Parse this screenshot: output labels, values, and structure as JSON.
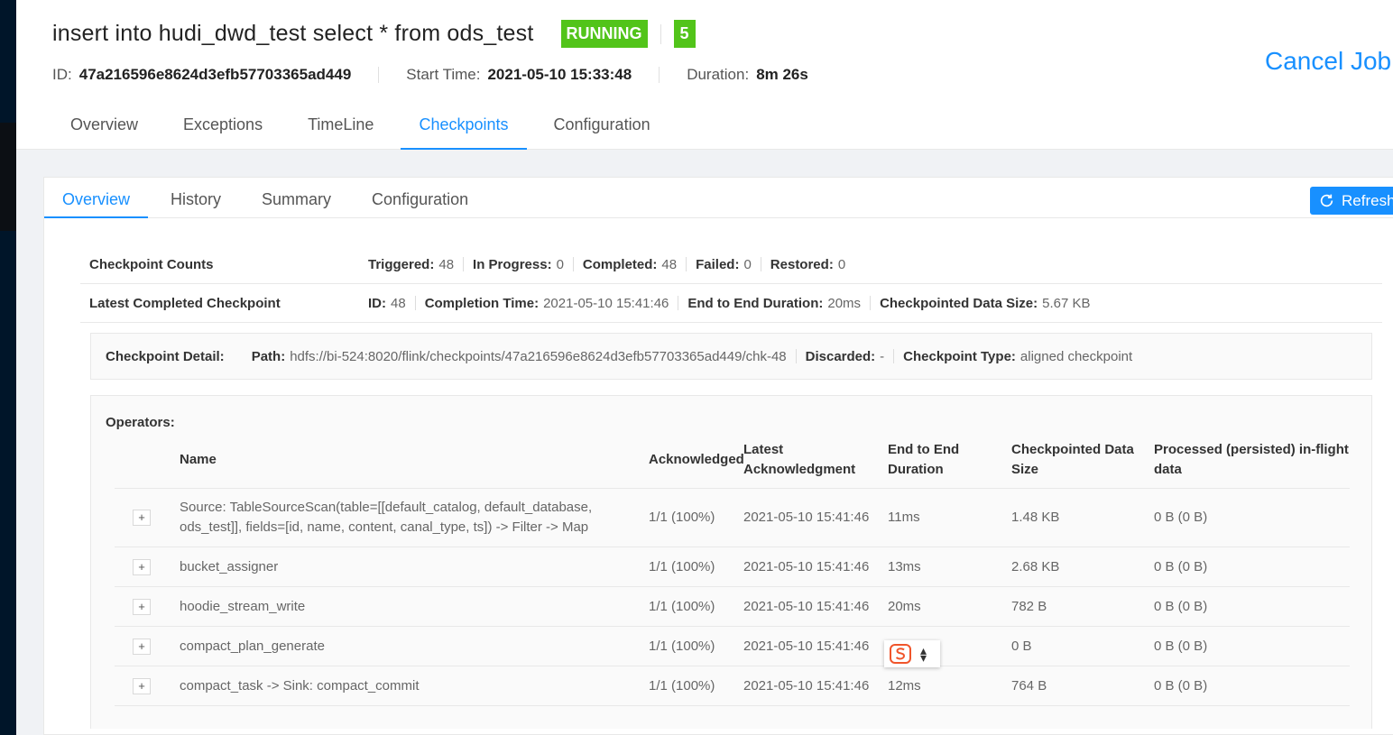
{
  "job": {
    "title": "insert into hudi_dwd_test select * from ods_test",
    "status": "RUNNING",
    "parallelism": "5",
    "id_label": "ID:",
    "id": "47a216596e8624d3efb57703365ad449",
    "start_time_label": "Start Time:",
    "start_time": "2021-05-10 15:33:48",
    "duration_label": "Duration:",
    "duration": "8m 26s",
    "cancel_label": "Cancel Job"
  },
  "tabs": [
    "Overview",
    "Exceptions",
    "TimeLine",
    "Checkpoints",
    "Configuration"
  ],
  "subtabs": [
    "Overview",
    "History",
    "Summary",
    "Configuration"
  ],
  "refresh_label": "Refresh",
  "counts": {
    "label": "Checkpoint Counts",
    "triggered_label": "Triggered:",
    "triggered": "48",
    "in_progress_label": "In Progress:",
    "in_progress": "0",
    "completed_label": "Completed:",
    "completed": "48",
    "failed_label": "Failed:",
    "failed": "0",
    "restored_label": "Restored:",
    "restored": "0"
  },
  "latest": {
    "label": "Latest Completed Checkpoint",
    "id_label": "ID:",
    "id": "48",
    "completion_label": "Completion Time:",
    "completion": "2021-05-10 15:41:46",
    "e2e_label": "End to End Duration:",
    "e2e": "20ms",
    "size_label": "Checkpointed Data Size:",
    "size": "5.67 KB"
  },
  "detail": {
    "label": "Checkpoint Detail:",
    "path_label": "Path:",
    "path": "hdfs://bi-524:8020/flink/checkpoints/47a216596e8624d3efb57703365ad449/chk-48",
    "discarded_label": "Discarded:",
    "discarded": "-",
    "type_label": "Checkpoint Type:",
    "type": "aligned checkpoint"
  },
  "operators": {
    "label": "Operators:",
    "headers": {
      "name": "Name",
      "ack": "Acknowledged",
      "latest_ack": "Latest Acknowledgment",
      "e2e": "End to End Duration",
      "size": "Checkpointed Data Size",
      "inflight": "Processed (persisted) in-flight data"
    },
    "expand_symbol": "+",
    "rows": [
      {
        "name": "Source: TableSourceScan(table=[[default_catalog, default_database, ods_test]], fields=[id, name, content, canal_type, ts]) -> Filter -> Map",
        "ack": "1/1 (100%)",
        "latest": "2021-05-10 15:41:46",
        "e2e": "11ms",
        "size": "1.48 KB",
        "inflight": "0 B (0 B)"
      },
      {
        "name": "bucket_assigner",
        "ack": "1/1 (100%)",
        "latest": "2021-05-10 15:41:46",
        "e2e": "13ms",
        "size": "2.68 KB",
        "inflight": "0 B (0 B)"
      },
      {
        "name": "hoodie_stream_write",
        "ack": "1/1 (100%)",
        "latest": "2021-05-10 15:41:46",
        "e2e": "20ms",
        "size": "782 B",
        "inflight": "0 B (0 B)"
      },
      {
        "name": "compact_plan_generate",
        "ack": "1/1 (100%)",
        "latest": "2021-05-10 15:41:46",
        "e2e": "",
        "size": "0 B",
        "inflight": "0 B (0 B)"
      },
      {
        "name": "compact_task -> Sink: compact_commit",
        "ack": "1/1 (100%)",
        "latest": "2021-05-10 15:41:46",
        "e2e": "12ms",
        "size": "764 B",
        "inflight": "0 B (0 B)"
      }
    ]
  },
  "colors": {
    "accent": "#1890ff",
    "status": "#52c41a",
    "ime": "#f0552b"
  }
}
